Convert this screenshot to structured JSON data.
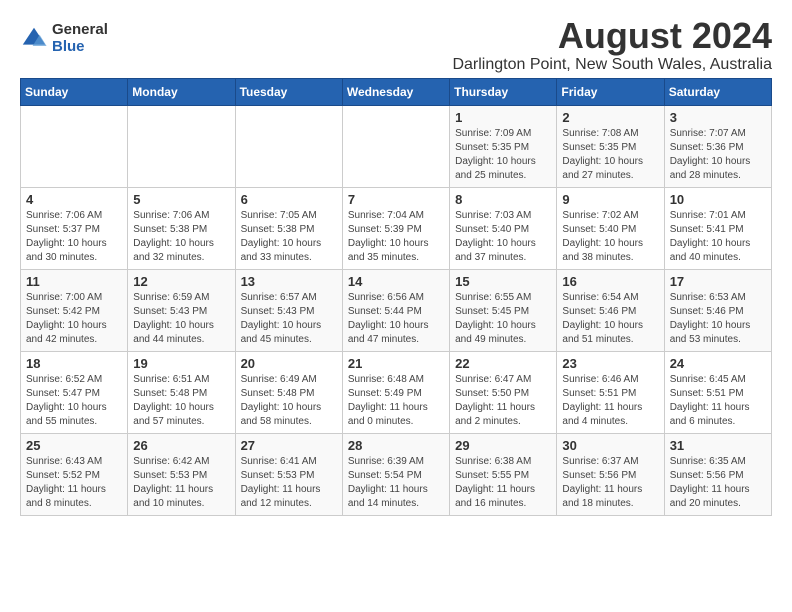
{
  "logo": {
    "general": "General",
    "blue": "Blue"
  },
  "title": "August 2024",
  "subtitle": "Darlington Point, New South Wales, Australia",
  "days_of_week": [
    "Sunday",
    "Monday",
    "Tuesday",
    "Wednesday",
    "Thursday",
    "Friday",
    "Saturday"
  ],
  "weeks": [
    [
      {
        "day": "",
        "detail": ""
      },
      {
        "day": "",
        "detail": ""
      },
      {
        "day": "",
        "detail": ""
      },
      {
        "day": "",
        "detail": ""
      },
      {
        "day": "1",
        "detail": "Sunrise: 7:09 AM\nSunset: 5:35 PM\nDaylight: 10 hours\nand 25 minutes."
      },
      {
        "day": "2",
        "detail": "Sunrise: 7:08 AM\nSunset: 5:35 PM\nDaylight: 10 hours\nand 27 minutes."
      },
      {
        "day": "3",
        "detail": "Sunrise: 7:07 AM\nSunset: 5:36 PM\nDaylight: 10 hours\nand 28 minutes."
      }
    ],
    [
      {
        "day": "4",
        "detail": "Sunrise: 7:06 AM\nSunset: 5:37 PM\nDaylight: 10 hours\nand 30 minutes."
      },
      {
        "day": "5",
        "detail": "Sunrise: 7:06 AM\nSunset: 5:38 PM\nDaylight: 10 hours\nand 32 minutes."
      },
      {
        "day": "6",
        "detail": "Sunrise: 7:05 AM\nSunset: 5:38 PM\nDaylight: 10 hours\nand 33 minutes."
      },
      {
        "day": "7",
        "detail": "Sunrise: 7:04 AM\nSunset: 5:39 PM\nDaylight: 10 hours\nand 35 minutes."
      },
      {
        "day": "8",
        "detail": "Sunrise: 7:03 AM\nSunset: 5:40 PM\nDaylight: 10 hours\nand 37 minutes."
      },
      {
        "day": "9",
        "detail": "Sunrise: 7:02 AM\nSunset: 5:40 PM\nDaylight: 10 hours\nand 38 minutes."
      },
      {
        "day": "10",
        "detail": "Sunrise: 7:01 AM\nSunset: 5:41 PM\nDaylight: 10 hours\nand 40 minutes."
      }
    ],
    [
      {
        "day": "11",
        "detail": "Sunrise: 7:00 AM\nSunset: 5:42 PM\nDaylight: 10 hours\nand 42 minutes."
      },
      {
        "day": "12",
        "detail": "Sunrise: 6:59 AM\nSunset: 5:43 PM\nDaylight: 10 hours\nand 44 minutes."
      },
      {
        "day": "13",
        "detail": "Sunrise: 6:57 AM\nSunset: 5:43 PM\nDaylight: 10 hours\nand 45 minutes."
      },
      {
        "day": "14",
        "detail": "Sunrise: 6:56 AM\nSunset: 5:44 PM\nDaylight: 10 hours\nand 47 minutes."
      },
      {
        "day": "15",
        "detail": "Sunrise: 6:55 AM\nSunset: 5:45 PM\nDaylight: 10 hours\nand 49 minutes."
      },
      {
        "day": "16",
        "detail": "Sunrise: 6:54 AM\nSunset: 5:46 PM\nDaylight: 10 hours\nand 51 minutes."
      },
      {
        "day": "17",
        "detail": "Sunrise: 6:53 AM\nSunset: 5:46 PM\nDaylight: 10 hours\nand 53 minutes."
      }
    ],
    [
      {
        "day": "18",
        "detail": "Sunrise: 6:52 AM\nSunset: 5:47 PM\nDaylight: 10 hours\nand 55 minutes."
      },
      {
        "day": "19",
        "detail": "Sunrise: 6:51 AM\nSunset: 5:48 PM\nDaylight: 10 hours\nand 57 minutes."
      },
      {
        "day": "20",
        "detail": "Sunrise: 6:49 AM\nSunset: 5:48 PM\nDaylight: 10 hours\nand 58 minutes."
      },
      {
        "day": "21",
        "detail": "Sunrise: 6:48 AM\nSunset: 5:49 PM\nDaylight: 11 hours\nand 0 minutes."
      },
      {
        "day": "22",
        "detail": "Sunrise: 6:47 AM\nSunset: 5:50 PM\nDaylight: 11 hours\nand 2 minutes."
      },
      {
        "day": "23",
        "detail": "Sunrise: 6:46 AM\nSunset: 5:51 PM\nDaylight: 11 hours\nand 4 minutes."
      },
      {
        "day": "24",
        "detail": "Sunrise: 6:45 AM\nSunset: 5:51 PM\nDaylight: 11 hours\nand 6 minutes."
      }
    ],
    [
      {
        "day": "25",
        "detail": "Sunrise: 6:43 AM\nSunset: 5:52 PM\nDaylight: 11 hours\nand 8 minutes."
      },
      {
        "day": "26",
        "detail": "Sunrise: 6:42 AM\nSunset: 5:53 PM\nDaylight: 11 hours\nand 10 minutes."
      },
      {
        "day": "27",
        "detail": "Sunrise: 6:41 AM\nSunset: 5:53 PM\nDaylight: 11 hours\nand 12 minutes."
      },
      {
        "day": "28",
        "detail": "Sunrise: 6:39 AM\nSunset: 5:54 PM\nDaylight: 11 hours\nand 14 minutes."
      },
      {
        "day": "29",
        "detail": "Sunrise: 6:38 AM\nSunset: 5:55 PM\nDaylight: 11 hours\nand 16 minutes."
      },
      {
        "day": "30",
        "detail": "Sunrise: 6:37 AM\nSunset: 5:56 PM\nDaylight: 11 hours\nand 18 minutes."
      },
      {
        "day": "31",
        "detail": "Sunrise: 6:35 AM\nSunset: 5:56 PM\nDaylight: 11 hours\nand 20 minutes."
      }
    ]
  ]
}
